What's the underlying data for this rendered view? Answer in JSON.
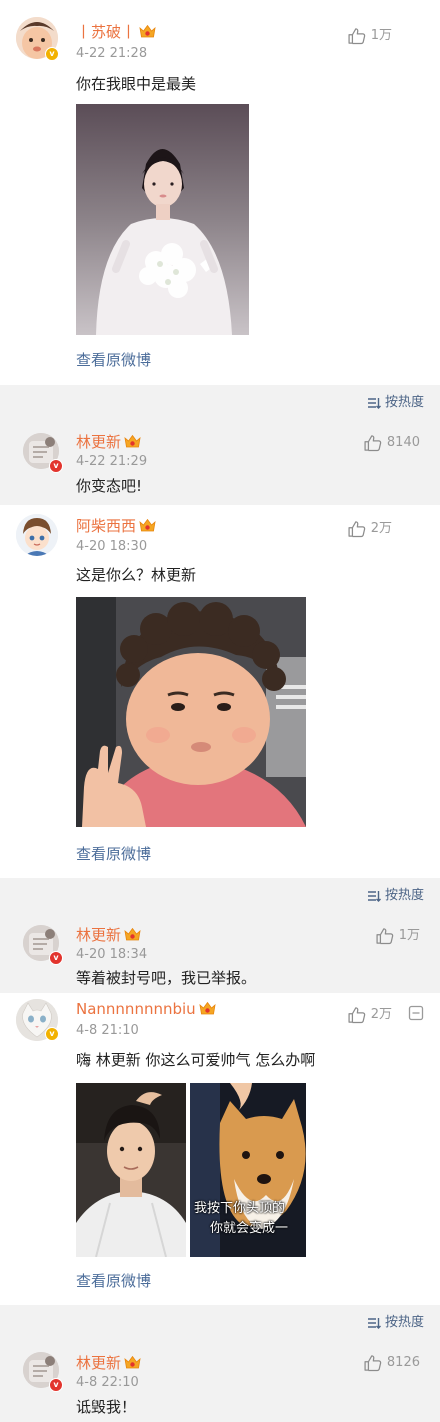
{
  "comments": [
    {
      "user": "丨苏破丨",
      "time": "4-22 21:28",
      "likes": "1万",
      "text": "你在我眼中是最美",
      "view_original": "查看原微博",
      "badge": "gold"
    },
    {
      "user": "林更新",
      "time": "4-22 21:29",
      "likes": "8140",
      "text": "你变态吧!",
      "badge": "red"
    },
    {
      "user": "阿柴西西",
      "time": "4-20 18:30",
      "likes": "2万",
      "text": "这是你么？林更新",
      "view_original": "查看原微博",
      "badge": "none"
    },
    {
      "user": "林更新",
      "time": "4-20 18:34",
      "likes": "1万",
      "text": "等着被封号吧，我已举报。",
      "badge": "red"
    },
    {
      "user": "Nannnnnnnnbiu",
      "time": "4-8 21:10",
      "likes": "2万",
      "text": "嗨 林更新 你这么可爱帅气 怎么办啊",
      "view_original": "查看原微博",
      "image_caption_line1": "我按下你头顶的",
      "image_caption_line2": "你就会变成一",
      "badge": "gold"
    },
    {
      "user": "林更新",
      "time": "4-8 22:10",
      "likes": "8126",
      "text": "诋毁我！",
      "badge": "red"
    }
  ],
  "sort_label": "按热度",
  "icons": {
    "like": "thumbs-up-icon",
    "sort": "sort-icon",
    "member": "crown-badge-icon",
    "more": "more-icon"
  },
  "colors": {
    "username": "#eb7340",
    "link": "#4c6d9a",
    "muted": "#999999",
    "background": "#f2f2f2"
  }
}
